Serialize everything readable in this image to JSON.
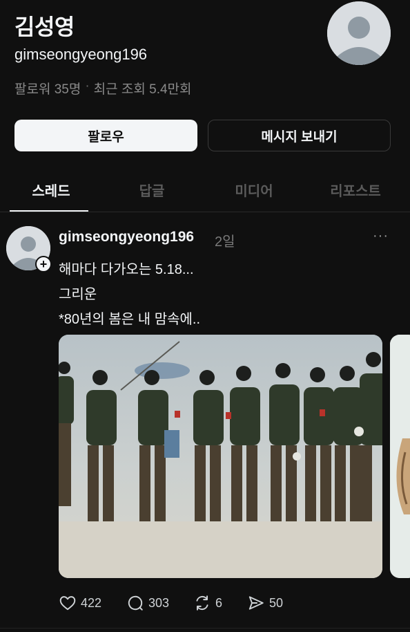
{
  "profile": {
    "name": "김성영",
    "handle": "gimseongyeong196",
    "followers": "팔로워 35명",
    "separator": "·",
    "views": "최근 조회 5.4만회"
  },
  "buttons": {
    "follow": "팔로우",
    "message": "메시지 보내기"
  },
  "tabs": [
    {
      "label": "스레드",
      "active": true
    },
    {
      "label": "답글",
      "active": false
    },
    {
      "label": "미디어",
      "active": false
    },
    {
      "label": "리포스트",
      "active": false
    }
  ],
  "post": {
    "username": "gimseongyeong196",
    "time": "2일",
    "more": "···",
    "follow_badge": "+",
    "lines": [
      "해마다 다가오는 5.18...",
      "그리운",
      "*80년의 봄은 내 맘속에.."
    ],
    "media_icons": [
      "photo-soldiers",
      "photo-partial"
    ],
    "actions": {
      "likes": "422",
      "comments": "303",
      "reposts": "6",
      "shares": "50"
    }
  },
  "colors": {
    "background": "#101010",
    "text": "#f3f5f7",
    "muted": "#8a8a8a",
    "avatar": "#d9dde1"
  }
}
